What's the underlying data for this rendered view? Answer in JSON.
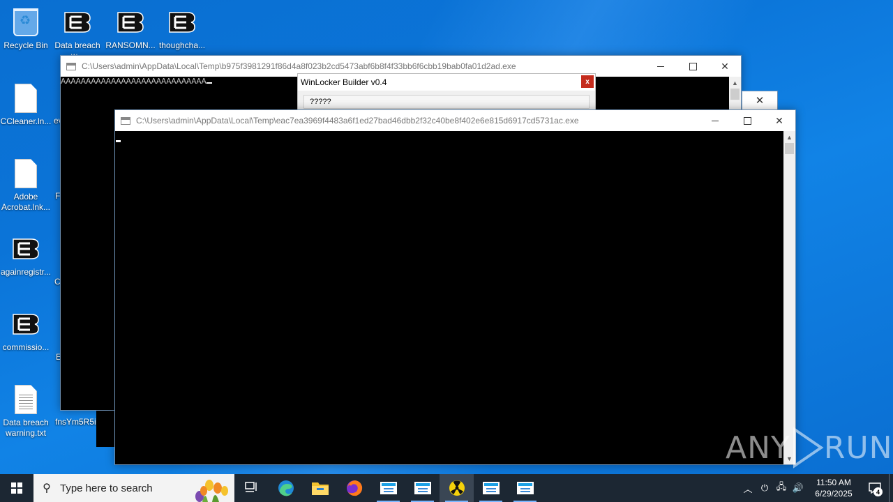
{
  "desktop": {
    "icons": [
      {
        "label": "Recycle Bin"
      },
      {
        "label": "Data breach w..."
      },
      {
        "label": "RANSOMN..."
      },
      {
        "label": "thoughcha..."
      },
      {
        "label": "CCleaner.ln..."
      },
      {
        "label": "Adobe Acrobat.lnk..."
      },
      {
        "label": "againregistr..."
      },
      {
        "label": "commissio..."
      },
      {
        "label": "Data breach warning.txt"
      },
      {
        "label": "fnsYm5R5i..."
      }
    ],
    "partial_labels": [
      "ev",
      "F",
      "C",
      "E"
    ]
  },
  "window_back": {
    "title": "C:\\Users\\admin\\AppData\\Local\\Temp\\b975f3981291f86d4a8f023b2cd5473abf6b8f4f33bb6f6cbb19bab0fa01d2ad.exe",
    "console_text": "AAAAAAAAAAAAAAAAAAAAAAAAAAAAA"
  },
  "winlocker": {
    "title": "WinLocker Builder v0.4",
    "close": "x",
    "field_text": "?????"
  },
  "window_front": {
    "title": "C:\\Users\\admin\\AppData\\Local\\Temp\\eac7ea3969f4483a6f1ed27bad46dbb2f32c40be8f402e6e815d6917cd5731ac.exe"
  },
  "taskbar": {
    "search_placeholder": "Type here to search",
    "time": "11:50 AM",
    "date": "6/29/2025",
    "notification_count": "4"
  },
  "watermark": {
    "left": "ANY",
    "right": "RUN"
  }
}
